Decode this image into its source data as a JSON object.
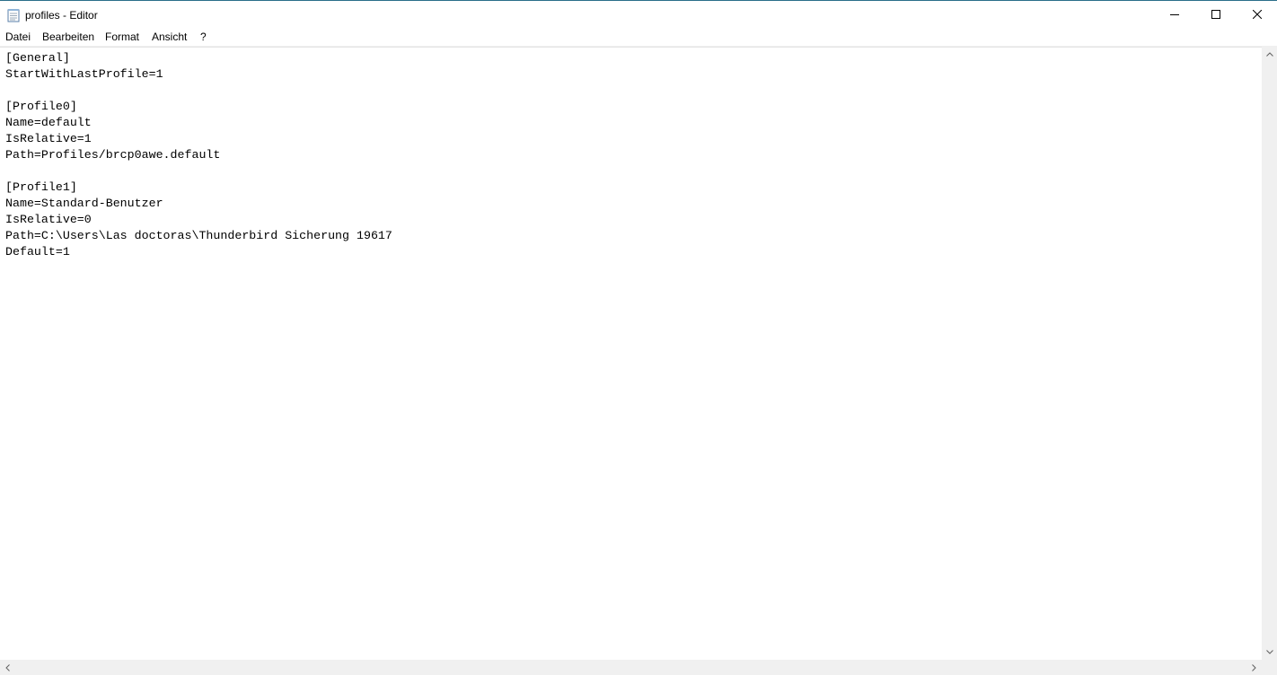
{
  "window": {
    "title": "profiles - Editor",
    "app_icon": "notepad-icon",
    "controls": {
      "minimize_icon": "minimize-icon",
      "maximize_icon": "maximize-icon",
      "close_icon": "close-icon"
    }
  },
  "menu": {
    "items": [
      {
        "label": "Datei"
      },
      {
        "label": "Bearbeiten"
      },
      {
        "label": "Format"
      },
      {
        "label": "Ansicht"
      },
      {
        "label": "?"
      }
    ]
  },
  "editor": {
    "lines": [
      "[General]",
      "StartWithLastProfile=1",
      "",
      "[Profile0]",
      "Name=default",
      "IsRelative=1",
      "Path=Profiles/brcp0awe.default",
      "",
      "[Profile1]",
      "Name=Standard-Benutzer",
      "IsRelative=0",
      "Path=C:\\Users\\Las doctoras\\Thunderbird Sicherung 19617",
      "Default=1"
    ]
  },
  "scrollbars": {
    "vertical": {
      "up_icon": "chevron-up-icon",
      "down_icon": "chevron-down-icon"
    },
    "horizontal": {
      "left_icon": "chevron-left-icon",
      "right_icon": "chevron-right-icon"
    }
  },
  "colors": {
    "accent_top_line": "#2b6f8a",
    "scrollbar_track": "#f0f0f0",
    "text": "#000000"
  }
}
